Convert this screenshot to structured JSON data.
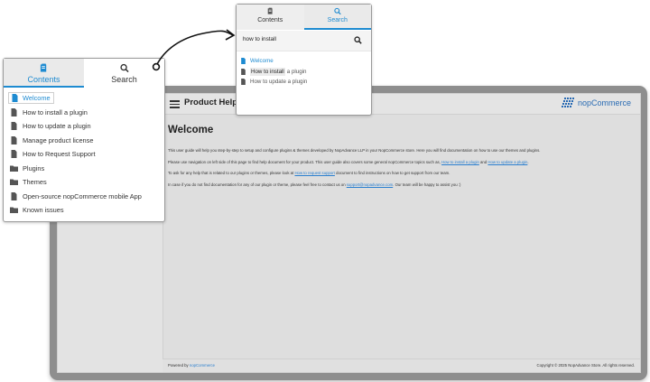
{
  "app": {
    "header_title": "Product Help",
    "brand_name": "nopCommerce"
  },
  "content": {
    "heading": "Welcome",
    "p1": "This user guide will help you step-by-step to setup and configure plugins & themes developed by NopAdvance LLP in your NopCommerce store. Here you will find documentation on how to use our themes and plugins.",
    "p2_pre": "Please use navigation on left side of this page to find help document for your product. This user guide also covers some general nopCommerce topics such as, ",
    "p2_link1": "How to install a plugin",
    "p2_mid": " and ",
    "p2_link2": "How to update a plugin",
    "p2_post": ".",
    "p3_pre": "To ask for any help that is related to our plugins or themes, please look at ",
    "p3_link": "How to request support",
    "p3_post": " document to find instructions on how to get support from our team.",
    "p4_pre": "In case if you do not find documentation for any of our plugin or theme, please feel free to contact us on ",
    "p4_link": "support@nopadvance.com",
    "p4_post": ". Our team will be happy to assist you :)"
  },
  "footer": {
    "powered_by": "Powered by ",
    "powered_link": "nopCommerce",
    "copyright": "Copyright © 2025 NopAdvance Store. All rights reserved."
  },
  "contents_panel": {
    "tab_contents": "Contents",
    "tab_search": "Search",
    "items": [
      {
        "label": "Welcome",
        "icon": "document-icon",
        "selected": true
      },
      {
        "label": "How to install a plugin",
        "icon": "document-icon"
      },
      {
        "label": "How to update a plugin",
        "icon": "document-icon"
      },
      {
        "label": "Manage product license",
        "icon": "document-icon"
      },
      {
        "label": "How to Request Support",
        "icon": "document-icon"
      },
      {
        "label": "Plugins",
        "icon": "folder-icon"
      },
      {
        "label": "Themes",
        "icon": "folder-icon"
      },
      {
        "label": "Open-source nopCommerce mobile App",
        "icon": "document-icon"
      },
      {
        "label": "Known issues",
        "icon": "folder-icon"
      }
    ]
  },
  "search_panel": {
    "tab_contents": "Contents",
    "tab_search": "Search",
    "query": "how to install",
    "results": [
      {
        "label": "Welcome",
        "selected": true
      },
      {
        "label_highlight": "How to install",
        "label_rest": " a plugin"
      },
      {
        "label": "How to update a plugin"
      }
    ]
  },
  "colors": {
    "accent": "#1e8bd1",
    "link": "#2a7fcf",
    "frame": "#8e8e8e"
  }
}
